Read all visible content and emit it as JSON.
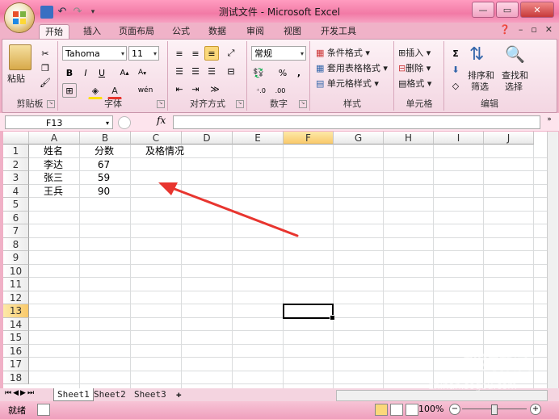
{
  "window": {
    "title": "测试文件 - Microsoft Excel"
  },
  "tabs": [
    "开始",
    "插入",
    "页面布局",
    "公式",
    "数据",
    "审阅",
    "视图",
    "开发工具"
  ],
  "ribbon": {
    "clipboard": {
      "label": "剪贴板",
      "paste": "粘贴"
    },
    "font": {
      "label": "字体",
      "name": "Tahoma",
      "size": "11",
      "bold": "B",
      "italic": "I",
      "underline": "U"
    },
    "alignment": {
      "label": "对齐方式"
    },
    "number": {
      "label": "数字",
      "format": "常规",
      "percent": "%",
      "comma": ","
    },
    "styles": {
      "label": "样式",
      "conditional": "条件格式",
      "table": "套用表格格式",
      "cell_styles": "单元格样式"
    },
    "cells": {
      "label": "单元格",
      "insert": "插入",
      "delete": "删除",
      "format": "格式"
    },
    "editing": {
      "label": "编辑",
      "sum": "Σ",
      "sort": "排序和",
      "sort2": "筛选",
      "find": "查找和",
      "find2": "选择"
    }
  },
  "formula_bar": {
    "name_box": "F13",
    "fx": "fx"
  },
  "grid": {
    "columns": [
      "A",
      "B",
      "C",
      "D",
      "E",
      "F",
      "G",
      "H",
      "I",
      "J"
    ],
    "rows": [
      "1",
      "2",
      "3",
      "4",
      "5",
      "6",
      "7",
      "8",
      "9",
      "10",
      "11",
      "12",
      "13",
      "14",
      "15",
      "16",
      "17",
      "18"
    ],
    "cells": [
      {
        "ref": "A1",
        "text": "姓名"
      },
      {
        "ref": "B1",
        "text": "分数"
      },
      {
        "ref": "C1",
        "text": "及格情况"
      },
      {
        "ref": "A2",
        "text": "李达"
      },
      {
        "ref": "B2",
        "text": "67"
      },
      {
        "ref": "A3",
        "text": "张三"
      },
      {
        "ref": "B3",
        "text": "59"
      },
      {
        "ref": "A4",
        "text": "王兵"
      },
      {
        "ref": "B4",
        "text": "90"
      }
    ],
    "active_cell": "F13"
  },
  "sheets": [
    "Sheet1",
    "Sheet2",
    "Sheet3"
  ],
  "status": {
    "ready": "就绪",
    "zoom": "100%"
  },
  "watermark": {
    "brand": "搜狗指南",
    "url": "zhinan.sogou.com"
  },
  "colors": {
    "accent": "#f27aa6",
    "arrow": "#e8352f",
    "selection_header": "#f9c96a"
  }
}
